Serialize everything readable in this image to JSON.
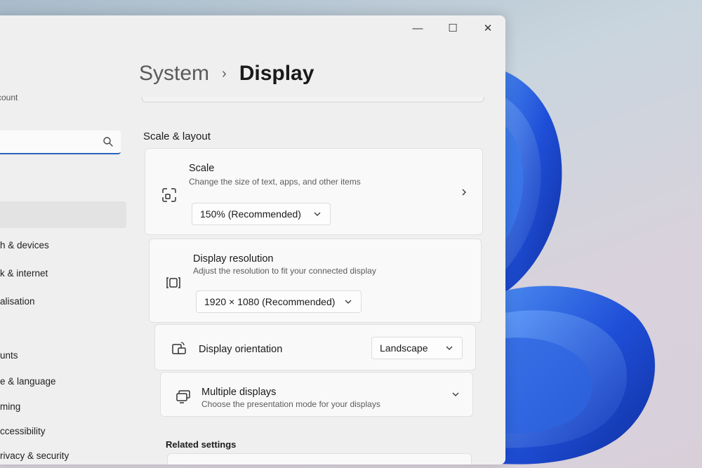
{
  "window": {
    "controls": {
      "minimize": "—",
      "maximize": "☐",
      "close": "✕"
    }
  },
  "sidebar": {
    "account_text": "ccount",
    "search": {
      "value": "",
      "placeholder": ""
    },
    "items": [
      {
        "label": "h & devices"
      },
      {
        "label": "k & internet"
      },
      {
        "label": "alisation"
      },
      {
        "label": "unts"
      },
      {
        "label": "e & language"
      },
      {
        "label": "ming"
      },
      {
        "label": "ccessibility"
      },
      {
        "label": "rivacy & security"
      }
    ]
  },
  "breadcrumb": {
    "parent": "System",
    "separator": "›",
    "current": "Display"
  },
  "main": {
    "section_title": "Scale & layout",
    "scale": {
      "title": "Scale",
      "subtitle": "Change the size of text, apps, and other items",
      "value": "150% (Recommended)"
    },
    "resolution": {
      "title": "Display resolution",
      "subtitle": "Adjust the resolution to fit your connected display",
      "value": "1920 × 1080 (Recommended)"
    },
    "orientation": {
      "title": "Display orientation",
      "value": "Landscape"
    },
    "multiple": {
      "title": "Multiple displays",
      "subtitle": "Choose the presentation mode for your displays"
    },
    "related_title": "Related settings"
  },
  "colors": {
    "accent": "#2a64b8",
    "window_bg": "#efefef",
    "card_bg": "#f9f9f9",
    "wallpaper_bloom": "#1f4fd8"
  },
  "icons": [
    "scale-icon",
    "resolution-icon",
    "orientation-icon",
    "multiple-displays-icon",
    "search-icon",
    "chevron-right-icon",
    "chevron-down-icon"
  ]
}
